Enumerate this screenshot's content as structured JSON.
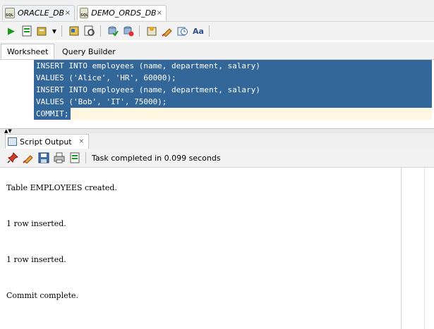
{
  "doc_tabs": [
    {
      "label": "ORACLE_DB",
      "close": "×"
    },
    {
      "label": "DEMO_ORDS_DB",
      "close": "×"
    }
  ],
  "toolbar": {
    "icons": [
      "run-statement-icon",
      "run-script-icon",
      "autotrace-icon",
      "explain-plan-icon",
      "sql-tuning-icon",
      "commit-icon",
      "rollback-icon",
      "unshared-sql-icon",
      "clear-icon",
      "history-icon",
      "format-icon"
    ]
  },
  "editor_tabs": [
    "Worksheet",
    "Query Builder"
  ],
  "code_lines": [
    "INSERT INTO employees (name, department, salary)",
    "VALUES ('Alice', 'HR', 60000);",
    "INSERT INTO employees (name, department, salary)",
    "VALUES ('Bob', 'IT', 75000);",
    "COMMIT;"
  ],
  "output_panel": {
    "tab_label": "Script Output",
    "tab_close": "×",
    "status": "Task completed in 0.099 seconds",
    "lines": [
      "Table EMPLOYEES created.",
      "1 row inserted.",
      "1 row inserted.",
      "Commit complete."
    ]
  },
  "colors": {
    "selection": "#336699",
    "current_line": "#fdf7e1"
  }
}
